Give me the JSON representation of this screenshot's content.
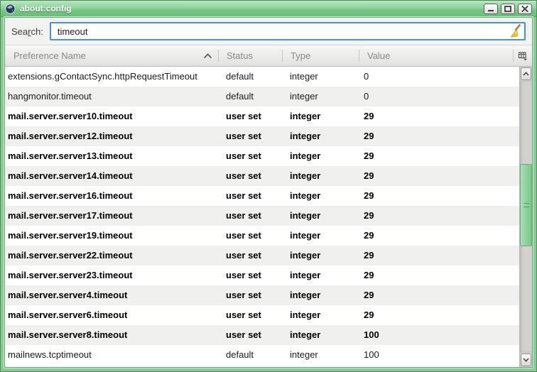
{
  "window": {
    "title": "about:config"
  },
  "search": {
    "label_pre": "Sea",
    "label_mnemonic": "r",
    "label_post": "ch:",
    "value": "timeout"
  },
  "table": {
    "columns": [
      "Preference Name",
      "Status",
      "Type",
      "Value"
    ],
    "sort": {
      "column": "Preference Name",
      "direction": "ascending"
    },
    "rows": [
      {
        "name": "extensions.gContactSync.httpRequestTimeout",
        "status": "default",
        "type": "integer",
        "value": "0"
      },
      {
        "name": "hangmonitor.timeout",
        "status": "default",
        "type": "integer",
        "value": "0"
      },
      {
        "name": "mail.server.server10.timeout",
        "status": "user set",
        "type": "integer",
        "value": "29"
      },
      {
        "name": "mail.server.server12.timeout",
        "status": "user set",
        "type": "integer",
        "value": "29"
      },
      {
        "name": "mail.server.server13.timeout",
        "status": "user set",
        "type": "integer",
        "value": "29"
      },
      {
        "name": "mail.server.server14.timeout",
        "status": "user set",
        "type": "integer",
        "value": "29"
      },
      {
        "name": "mail.server.server16.timeout",
        "status": "user set",
        "type": "integer",
        "value": "29"
      },
      {
        "name": "mail.server.server17.timeout",
        "status": "user set",
        "type": "integer",
        "value": "29"
      },
      {
        "name": "mail.server.server19.timeout",
        "status": "user set",
        "type": "integer",
        "value": "29"
      },
      {
        "name": "mail.server.server22.timeout",
        "status": "user set",
        "type": "integer",
        "value": "29"
      },
      {
        "name": "mail.server.server23.timeout",
        "status": "user set",
        "type": "integer",
        "value": "29"
      },
      {
        "name": "mail.server.server4.timeout",
        "status": "user set",
        "type": "integer",
        "value": "29"
      },
      {
        "name": "mail.server.server6.timeout",
        "status": "user set",
        "type": "integer",
        "value": "29"
      },
      {
        "name": "mail.server.server8.timeout",
        "status": "user set",
        "type": "integer",
        "value": "100"
      },
      {
        "name": "mailnews.tcptimeout",
        "status": "default",
        "type": "integer",
        "value": "100"
      }
    ]
  },
  "colors": {
    "titlebar_green": "#8ed49c",
    "window_border_green": "#4c8a59",
    "focus_border_blue": "#4a90d9",
    "row_alt_gray": "#f0f0ee",
    "header_text_gray": "#8a8a8a",
    "scrollbar_thumb_green": "#8ccf9b"
  }
}
